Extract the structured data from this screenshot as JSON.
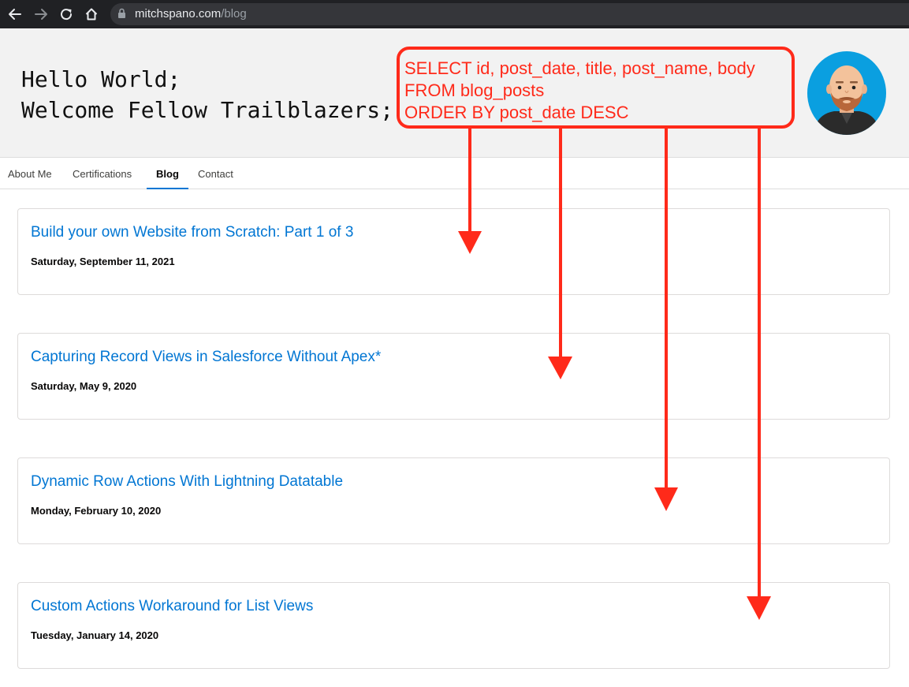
{
  "browser": {
    "url_host": "mitchspano.com",
    "url_path": "/blog"
  },
  "header": {
    "line1": "Hello World;",
    "line2": "Welcome Fellow Trailblazers;"
  },
  "tabs": [
    {
      "label": "About Me",
      "active": false
    },
    {
      "label": "Certifications",
      "active": false
    },
    {
      "label": "Blog",
      "active": true
    },
    {
      "label": "Contact",
      "active": false
    }
  ],
  "posts": [
    {
      "title": "Build your own Website from Scratch: Part 1 of 3",
      "date": "Saturday, September 11, 2021"
    },
    {
      "title": "Capturing Record Views in Salesforce Without Apex*",
      "date": "Saturday, May 9, 2020"
    },
    {
      "title": "Dynamic Row Actions With Lightning Datatable",
      "date": "Monday, February 10, 2020"
    },
    {
      "title": "Custom Actions Workaround for List Views",
      "date": "Tuesday, January 14, 2020"
    }
  ],
  "annotation": {
    "lines": [
      "SELECT id, post_date, title, post_name, body",
      "FROM blog_posts",
      "ORDER BY post_date DESC"
    ],
    "color": "#ff2a1a"
  },
  "colors": {
    "link": "#0176d3",
    "tab_active_underline": "#0176d3",
    "header_bg": "#f2f2f2",
    "chrome_bg": "#202124",
    "avatar_bg": "#0a9fe0"
  }
}
